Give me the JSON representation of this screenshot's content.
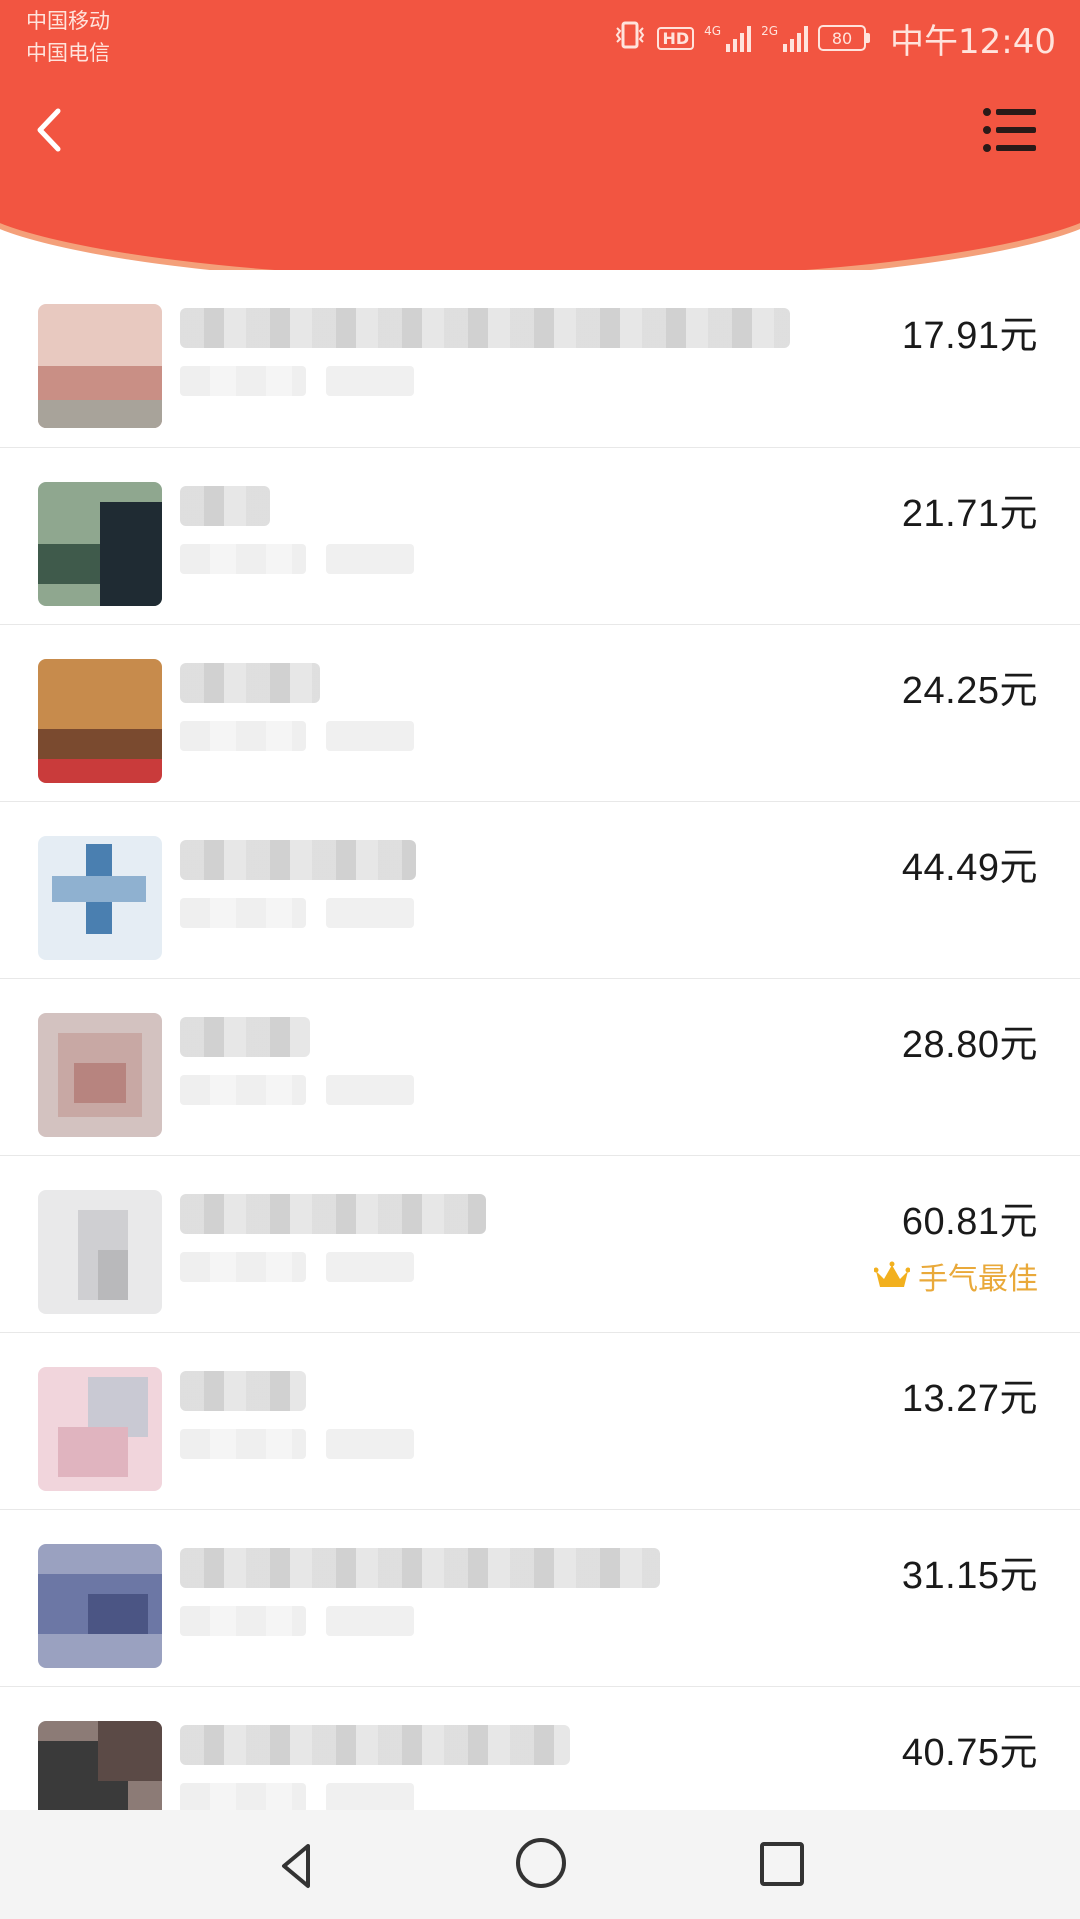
{
  "status_bar": {
    "carrier_1": "中国移动",
    "carrier_2": "中国电信",
    "hd": "HD",
    "net_1": "4G",
    "net_2": "2G",
    "battery": "80",
    "time": "中午12:40"
  },
  "header": {
    "back_icon": "chevron-left-icon",
    "menu_icon": "list-menu-icon",
    "color": "#f25541"
  },
  "records": [
    {
      "amount": "17.91元",
      "avatar": [
        "#e8c9c0",
        "#c98f85",
        "#a8a39a"
      ]
    },
    {
      "amount": "21.71元",
      "avatar": [
        "#8fa78f",
        "#3f5a4b",
        "#1f2b33"
      ]
    },
    {
      "amount": "24.25元",
      "avatar": [
        "#c78b4c",
        "#7a4a2f",
        "#c93b3b"
      ]
    },
    {
      "amount": "44.49元",
      "avatar": [
        "#e5edf4",
        "#4a7fb0",
        "#8fb1d0"
      ]
    },
    {
      "amount": "28.80元",
      "avatar": [
        "#c8a8a4",
        "#b7847f",
        "#d3c2c0"
      ]
    },
    {
      "amount": "60.81元",
      "avatar": [
        "#e9e9ea",
        "#cfcfd2",
        "#b9b9bb"
      ],
      "badge": "手气最佳",
      "badge_icon": "crown-icon"
    },
    {
      "amount": "13.27元",
      "avatar": [
        "#f1d5dc",
        "#e0b4bf",
        "#c9c9d3"
      ]
    },
    {
      "amount": "31.15元",
      "avatar": [
        "#6c77a5",
        "#4b5584",
        "#9aa1c0"
      ]
    },
    {
      "amount": "40.75元",
      "avatar": [
        "#3a3a3a",
        "#5b4a46",
        "#8c7b76"
      ]
    }
  ],
  "nav": {
    "back_icon": "nav-back-icon",
    "home_icon": "nav-home-icon",
    "recent_icon": "nav-recent-icon"
  }
}
